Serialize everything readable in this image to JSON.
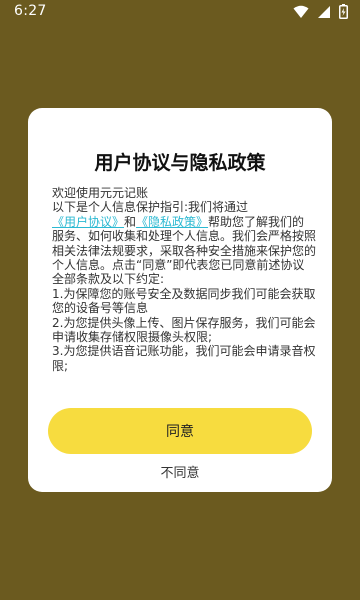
{
  "status_bar": {
    "time": "6:27"
  },
  "dialog": {
    "title": "用户协议与隐私政策",
    "body": {
      "greeting": "欢迎使用元元记账",
      "intro_prefix": "以下是个人信息保护指引:我们将通过",
      "user_agreement_link": "《用户协议》",
      "and_text": "和",
      "privacy_policy_link": "《隐私政策》",
      "intro_suffix": "帮助您了解我们的服务、如何收集和处理个人信息。我们会严格按照相关法律法规要求，采取各种安全措施来保护您的个人信息。点击“同意”即代表您已同意前述协议全部条款及以下约定:",
      "item1": "1.为保障您的账号安全及数据同步我们可能会获取您的设备号等信息",
      "item2": "2.为您提供头像上传、图片保存服务，我们可能会申请收集存储权限摄像头权限;",
      "item3": "3.为您提供语音记账功能，我们可能会申请录音权限;"
    },
    "agree_label": "同意",
    "disagree_label": "不同意"
  },
  "colors": {
    "backdrop": "#6b5a1f",
    "accent_button": "#f7dc3f",
    "link": "#2bb9d2"
  }
}
